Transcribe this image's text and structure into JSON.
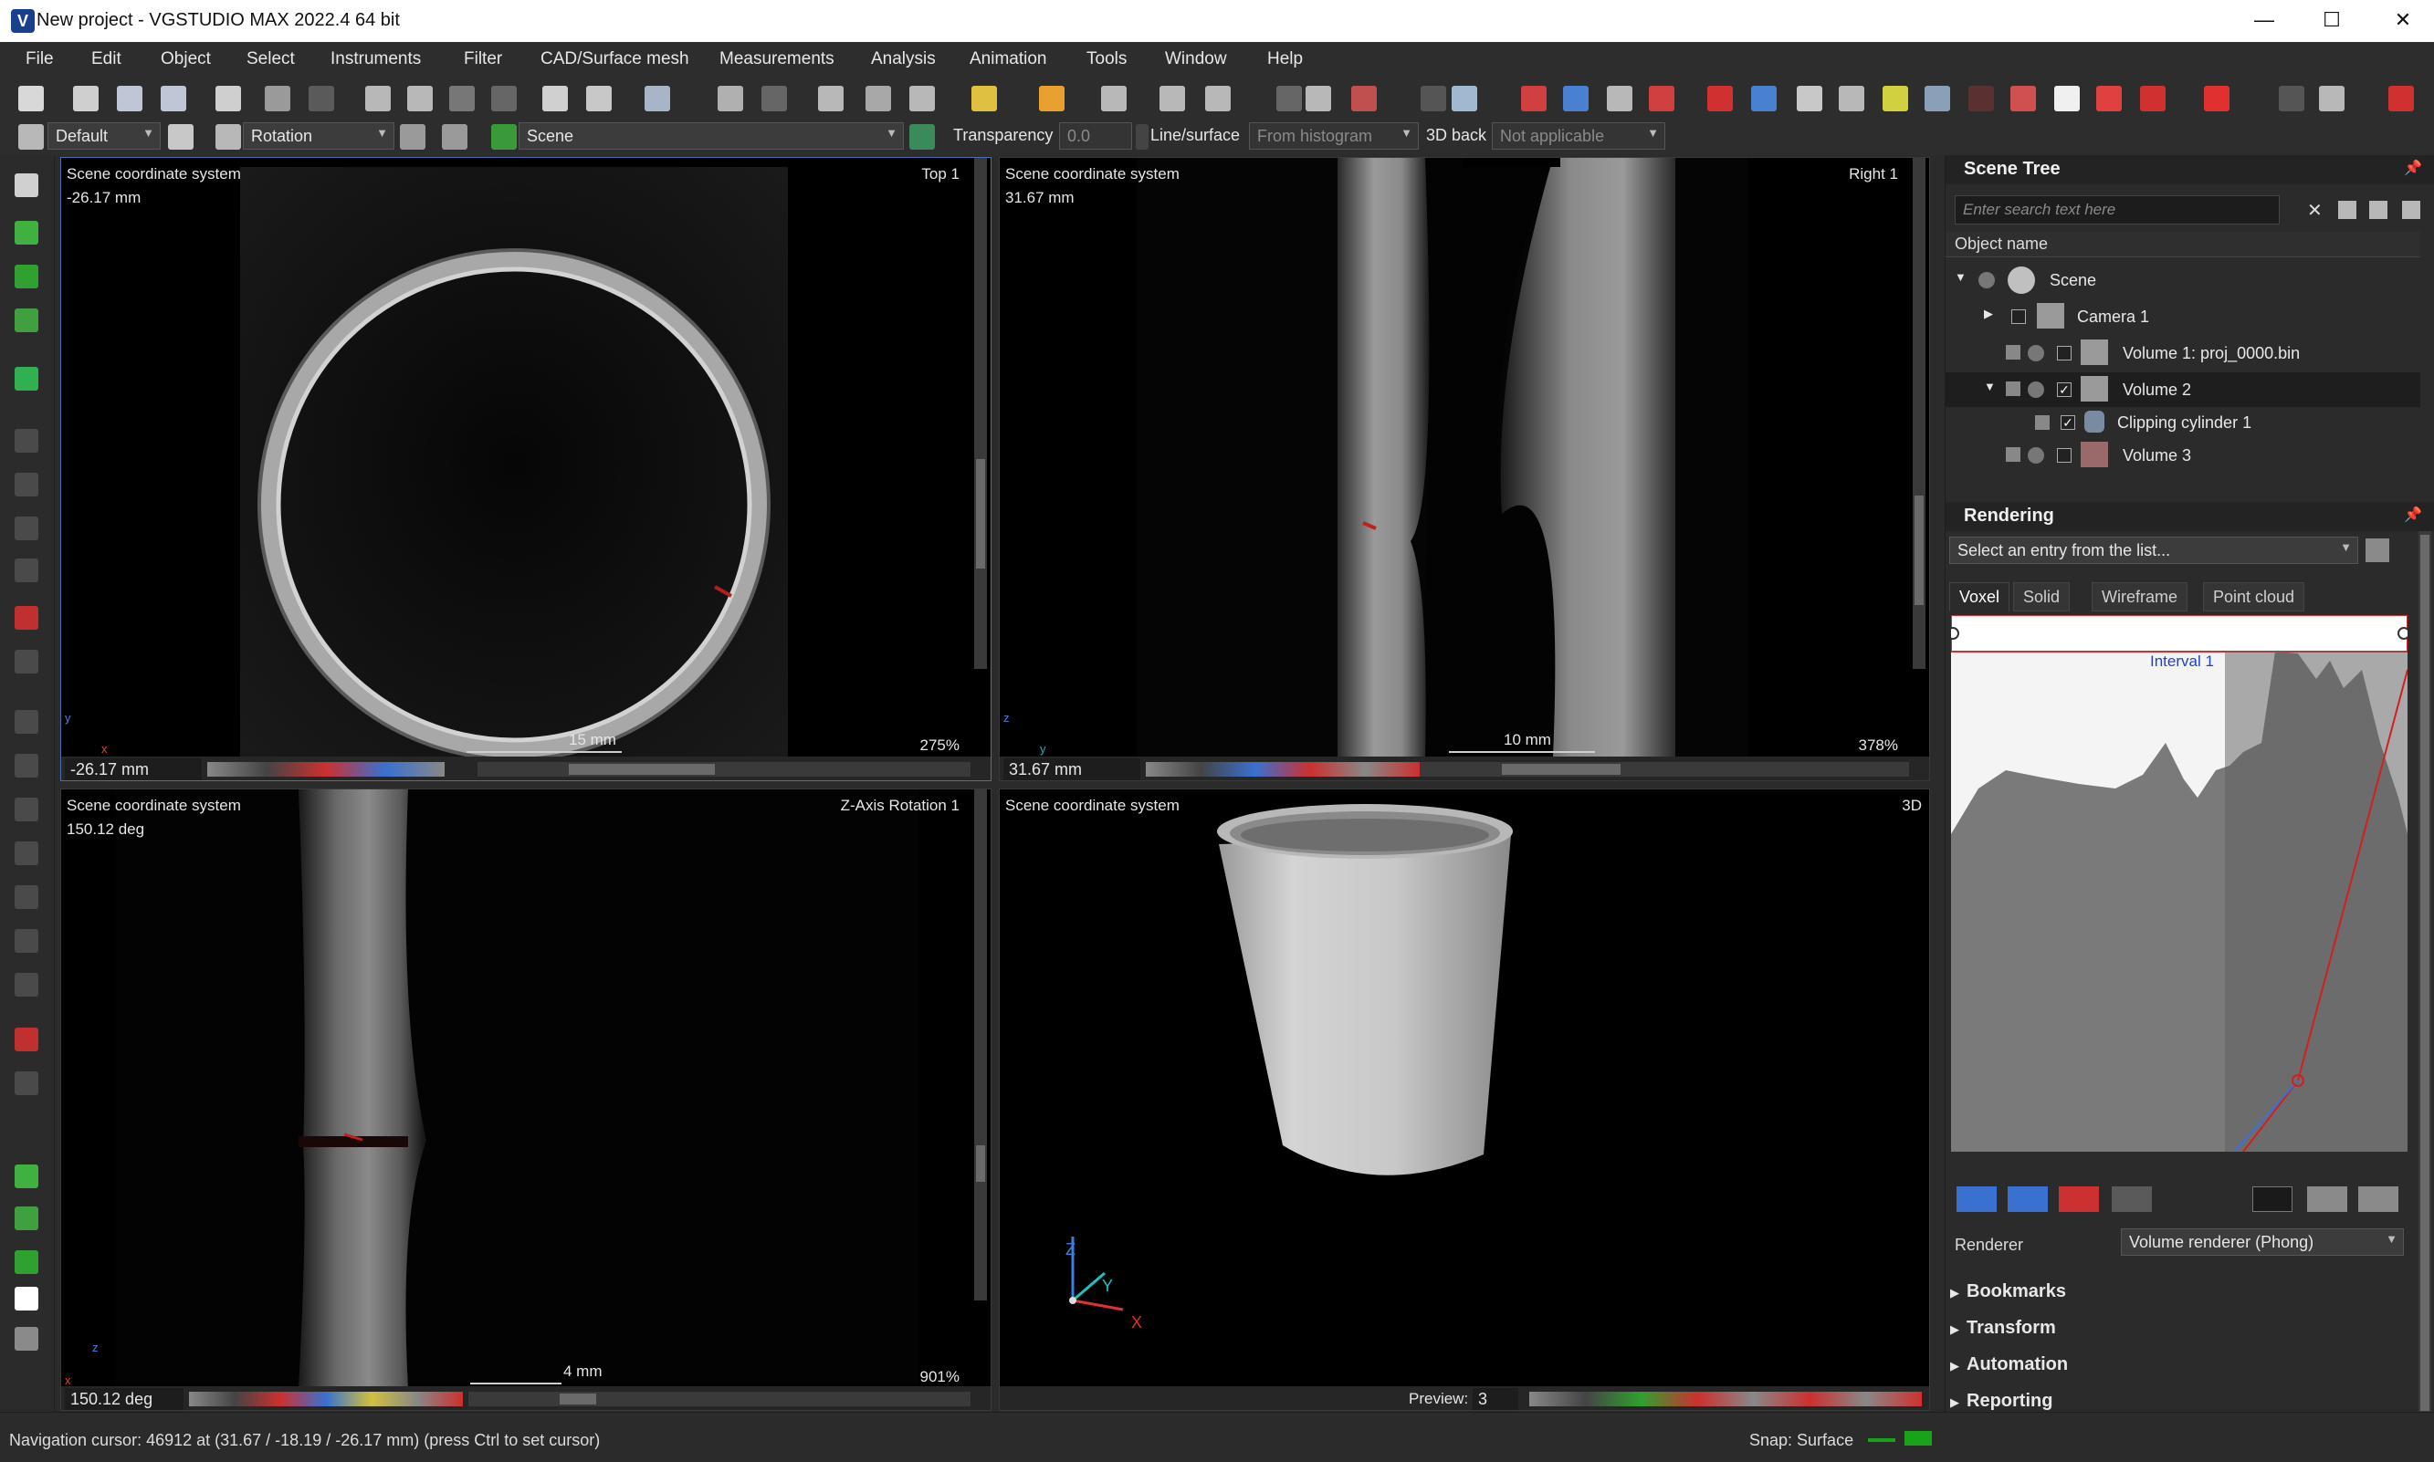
{
  "window": {
    "title": "New project  - VGSTUDIO MAX 2022.4 64 bit",
    "logo": "V",
    "minimize": "—",
    "maximize": "☐",
    "close": "✕"
  },
  "menu": [
    "File",
    "Edit",
    "Object",
    "Select",
    "Instruments",
    "Filter",
    "CAD/Surface mesh",
    "Measurements",
    "Analysis",
    "Animation",
    "Tools",
    "Window",
    "Help"
  ],
  "toolbar": {
    "layout_value": "Default",
    "mode_value": "Rotation",
    "scene_value": "Scene",
    "transparency_label": "Transparency",
    "transparency_value": "0.0",
    "line_surface_label": "Line/surface",
    "line_surface_value": "From histogram",
    "back_label": "3D back",
    "back_value": "Not applicable"
  },
  "views": {
    "top": {
      "coord_label": "Scene coordinate system",
      "position": "-26.17 mm",
      "name": "Top 1",
      "scale_label": "15 mm",
      "zoom": "275%",
      "field_value": "-26.17 mm",
      "axis_x": "x",
      "axis_y": "y"
    },
    "right": {
      "coord_label": "Scene coordinate system",
      "position": "31.67 mm",
      "name": "Right 1",
      "scale_label": "10 mm",
      "zoom": "378%",
      "field_value": "31.67 mm",
      "axis_z": "z",
      "axis_y": "y"
    },
    "zrot": {
      "coord_label": "Scene coordinate system",
      "position": "150.12 deg",
      "name": "Z-Axis Rotation 1",
      "scale_label": "4 mm",
      "zoom": "901%",
      "field_value": "150.12 deg",
      "axis_z": "z",
      "axis_x": "x"
    },
    "three_d": {
      "coord_label": "Scene coordinate system",
      "name": "3D",
      "preview_label": "Preview:",
      "preview_value": "3",
      "axis_x": "X",
      "axis_y": "Y",
      "axis_z": "Z"
    }
  },
  "scene_tree": {
    "title": "Scene Tree",
    "search_placeholder": "Enter search text here",
    "column_header": "Object name",
    "items": [
      {
        "label": "Scene"
      },
      {
        "label": "Camera 1"
      },
      {
        "label": "Volume 1: proj_0000.bin"
      },
      {
        "label": "Volume 2"
      },
      {
        "label": "Clipping cylinder 1"
      },
      {
        "label": "Volume 3"
      }
    ]
  },
  "rendering": {
    "title": "Rendering",
    "preset_placeholder": "Select an entry from the list...",
    "tabs": [
      "Voxel",
      "Solid",
      "Wireframe",
      "Point cloud"
    ],
    "active_tab": "Voxel",
    "interval_label": "Interval 1",
    "renderer_label": "Renderer",
    "renderer_value": "Volume renderer (Phong)"
  },
  "sections": [
    "Bookmarks",
    "Transform",
    "Automation",
    "Reporting"
  ],
  "status": {
    "cursor_text": "Navigation cursor: 46912 at (31.67 / -18.19 / -26.17 mm) (press Ctrl to set cursor)",
    "snap_text": "Snap: Surface"
  },
  "colors": {
    "accent_blue": "#3a6fd8",
    "marker_red": "#e02020",
    "status_green": "#19a319"
  }
}
